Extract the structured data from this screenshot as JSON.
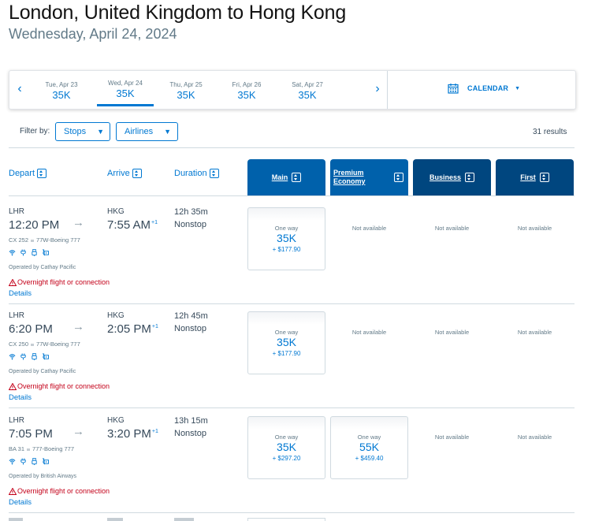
{
  "header": {
    "title": "London, United Kingdom to Hong Kong",
    "subtitle": "Wednesday, April 24, 2024"
  },
  "date_carousel": {
    "prev_icon": "chevron-left-icon",
    "next_icon": "chevron-right-icon",
    "dates": [
      {
        "label": "Tue, Apr 23",
        "price": "35K",
        "selected": false
      },
      {
        "label": "Wed, Apr 24",
        "price": "35K",
        "selected": true
      },
      {
        "label": "Thu, Apr 25",
        "price": "35K",
        "selected": false
      },
      {
        "label": "Fri, Apr 26",
        "price": "35K",
        "selected": false
      },
      {
        "label": "Sat, Apr 27",
        "price": "35K",
        "selected": false
      }
    ],
    "calendar_label": "CALENDAR"
  },
  "filters": {
    "label": "Filter by:",
    "stops_label": "Stops",
    "airlines_label": "Airlines",
    "results": "31 results"
  },
  "columns": {
    "depart": "Depart",
    "arrive": "Arrive",
    "duration": "Duration",
    "cabins": [
      "Main",
      "Premium Economy",
      "Business",
      "First"
    ]
  },
  "colors": {
    "accent": "#0078d2",
    "cabin_light": "#0061ab",
    "cabin_dark": "#00467f",
    "warning": "#c30019"
  },
  "flights": [
    {
      "origin": "LHR",
      "depart_time": "12:20 PM",
      "destination": "HKG",
      "arrive_time": "7:55 AM",
      "day_offset": "+1",
      "duration": "12h 35m",
      "stops": "Nonstop",
      "flight_number": "CX 252",
      "aircraft": "77W-Boeing 777",
      "amenities": [
        "wifi-icon",
        "power-outlet-icon",
        "usb-icon",
        "entertainment-icon"
      ],
      "operated_by": "Operated by Cathay Pacific",
      "warning": "Overnight flight or connection",
      "details_label": "Details",
      "fares": [
        {
          "available": true,
          "label": "One way",
          "miles": "35K",
          "tax": "+ $177.90"
        },
        {
          "available": false,
          "text": "Not available"
        },
        {
          "available": false,
          "text": "Not available"
        },
        {
          "available": false,
          "text": "Not available"
        }
      ]
    },
    {
      "origin": "LHR",
      "depart_time": "6:20 PM",
      "destination": "HKG",
      "arrive_time": "2:05 PM",
      "day_offset": "+1",
      "duration": "12h 45m",
      "stops": "Nonstop",
      "flight_number": "CX 250",
      "aircraft": "77W-Boeing 777",
      "amenities": [
        "wifi-icon",
        "power-outlet-icon",
        "usb-icon",
        "entertainment-icon"
      ],
      "operated_by": "Operated by Cathay Pacific",
      "warning": "Overnight flight or connection",
      "details_label": "Details",
      "fares": [
        {
          "available": true,
          "label": "One way",
          "miles": "35K",
          "tax": "+ $177.90"
        },
        {
          "available": false,
          "text": "Not available"
        },
        {
          "available": false,
          "text": "Not available"
        },
        {
          "available": false,
          "text": "Not available"
        }
      ]
    },
    {
      "origin": "LHR",
      "depart_time": "7:05 PM",
      "destination": "HKG",
      "arrive_time": "3:20 PM",
      "day_offset": "+1",
      "duration": "13h 15m",
      "stops": "Nonstop",
      "flight_number": "BA 31",
      "aircraft": "777-Boeing 777",
      "amenities": [
        "wifi-icon",
        "power-outlet-icon",
        "usb-icon",
        "entertainment-icon"
      ],
      "operated_by": "Operated by British Airways",
      "warning": "Overnight flight or connection",
      "details_label": "Details",
      "fares": [
        {
          "available": true,
          "label": "One way",
          "miles": "35K",
          "tax": "+ $297.20"
        },
        {
          "available": true,
          "label": "One way",
          "miles": "55K",
          "tax": "+ $459.40"
        },
        {
          "available": false,
          "text": "Not available"
        },
        {
          "available": false,
          "text": "Not available"
        }
      ]
    }
  ]
}
